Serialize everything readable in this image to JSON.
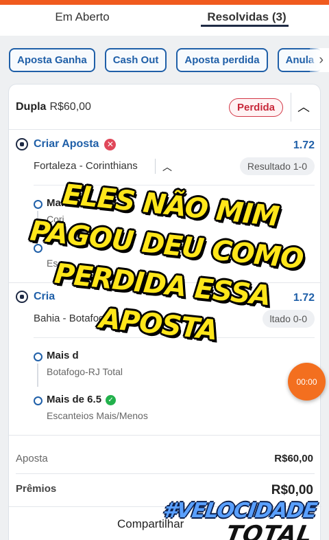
{
  "tabs": [
    {
      "label": "Em Aberto",
      "active": false
    },
    {
      "label": "Resolvidas (3)",
      "active": true
    }
  ],
  "filters": [
    "Aposta Ganha",
    "Cash Out",
    "Aposta perdida",
    "Anula"
  ],
  "bet": {
    "type": "Dupla",
    "amount": "R$60,00",
    "status": "Perdida",
    "selections": [
      {
        "name": "Criar Aposta",
        "odds": "1.72",
        "match": "Fortaleza - Corinthians",
        "result": "Resultado 1-0",
        "legs": [
          {
            "name": "Mais",
            "sub": "Cori"
          },
          {
            "name": "",
            "sub": "Es"
          }
        ]
      },
      {
        "name": "Cria",
        "odds": "1.72",
        "match": "Bahia - Botafogo",
        "result": "ltado 0-0",
        "legs": [
          {
            "name": "Mais d",
            "sub": "Botafogo-RJ Total"
          },
          {
            "name": "Mais de 6.5",
            "sub": "Escanteios Mais/Menos"
          }
        ]
      }
    ]
  },
  "summary": {
    "stake_label": "Aposta",
    "stake_value": "R$60,00",
    "prize_label": "Prêmios",
    "prize_value": "R$0,00"
  },
  "share_label": "Compartilhar",
  "timer": "00:00",
  "overlay_lines": [
    "ELES NÃO MIM",
    "PAGOU DEU COMO",
    "PERDIDA ESSA",
    "APOSTA"
  ],
  "watermark": {
    "line1": "#VELOCIDADE",
    "line2": "TOTAL"
  },
  "colors": {
    "accent": "#f05a1e",
    "link": "#1f5fa8",
    "lost": "#c8283a",
    "win": "#22b14c",
    "overlay": "#ffe61a"
  }
}
